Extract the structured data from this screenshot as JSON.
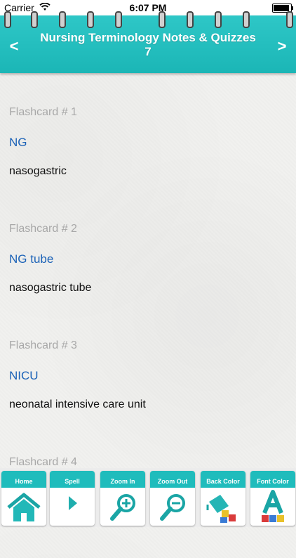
{
  "status_bar": {
    "carrier": "Carrier",
    "time": "6:07 PM"
  },
  "header": {
    "title_line1": "Nursing Terminology Notes & Quizzes",
    "title_line2": "7",
    "prev_label": "<",
    "next_label": ">"
  },
  "flashcards": [
    {
      "number": "Flashcard # 1",
      "term": "NG",
      "definition": "nasogastric"
    },
    {
      "number": "Flashcard # 2",
      "term": "NG tube",
      "definition": "nasogastric tube"
    },
    {
      "number": "Flashcard # 3",
      "term": "NICU",
      "definition": "neonatal intensive care unit"
    },
    {
      "number": "Flashcard # 4",
      "term": "",
      "definition": ""
    }
  ],
  "toolbar": {
    "home": "Home",
    "spell": "Spell",
    "zoom_in": "Zoom In",
    "zoom_out": "Zoom Out",
    "back_color": "Back Color",
    "font_color": "Font Color"
  },
  "colors": {
    "accent": "#1fbcbc",
    "term": "#1b62b7",
    "number": "#a8a8a8"
  }
}
